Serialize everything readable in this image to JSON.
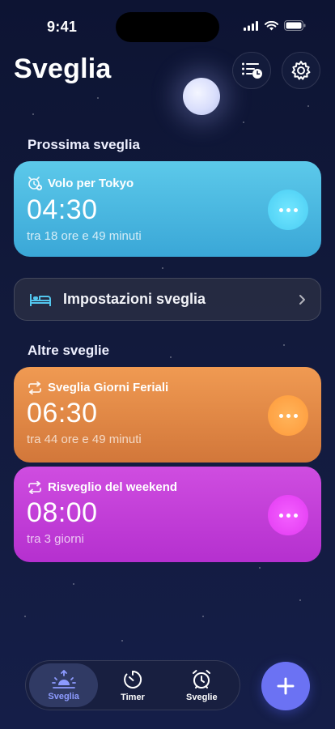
{
  "status_bar": {
    "time": "9:41"
  },
  "header": {
    "title": "Sveglia"
  },
  "sections": {
    "next": "Prossima sveglia",
    "others": "Altre sveglie"
  },
  "next_alarm": {
    "label": "Volo per Tokyo",
    "time": "04:30",
    "countdown": "tra 18 ore e 49 minuti",
    "color": "#4bb8e2"
  },
  "settings_row": {
    "label": "Impostazioni sveglia"
  },
  "other_alarms": [
    {
      "label": "Sveglia Giorni Feriali",
      "time": "06:30",
      "countdown": "tra 44 ore e 49 minuti",
      "color": "#e48845"
    },
    {
      "label": "Risveglio del weekend",
      "time": "08:00",
      "countdown": "tra 3 giorni",
      "color": "#c23dd7"
    }
  ],
  "tabs": [
    {
      "label": "Sveglia",
      "icon": "sunrise-icon",
      "active": true
    },
    {
      "label": "Timer",
      "icon": "timer-icon",
      "active": false
    },
    {
      "label": "Sveglie",
      "icon": "alarm-clock-icon",
      "active": false
    }
  ],
  "accent": "#6b72f3"
}
